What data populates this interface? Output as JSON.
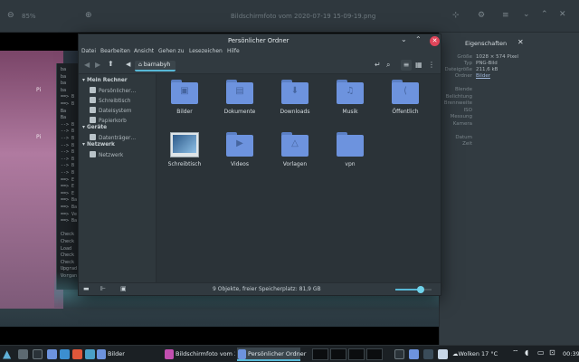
{
  "viewer": {
    "zoom": "85%",
    "title": "Bildschirmfoto vom 2020-07-19 15-09-19.png"
  },
  "properties": {
    "title": "Eigenschaften",
    "rows": [
      {
        "label": "Größe",
        "value": "1028 × 574 Pixel"
      },
      {
        "label": "Typ",
        "value": "PNG-Bild"
      },
      {
        "label": "Dateigröße",
        "value": "211,6 kB"
      },
      {
        "label": "Ordner",
        "value": "Bilder"
      }
    ],
    "labels_only": [
      "Blende",
      "Belichtung",
      "Brennweite",
      "ISO",
      "Messung",
      "Kamera",
      "",
      "Datum",
      "Zeit"
    ]
  },
  "file_manager": {
    "title": "Persönlicher Ordner",
    "menu": [
      "Datei",
      "Bearbeiten",
      "Ansicht",
      "Gehen zu",
      "Lesezeichen",
      "Hilfe"
    ],
    "path": "barnabyh",
    "sidebar": {
      "sections": [
        {
          "heading": "Mein Rechner",
          "items": [
            "Persönlicher…",
            "Schreibtisch",
            "Dateisystem",
            "Papierkorb"
          ]
        },
        {
          "heading": "Geräte",
          "items": [
            "Datenträger…"
          ]
        },
        {
          "heading": "Netzwerk",
          "items": [
            "Netzwerk"
          ]
        }
      ]
    },
    "items": [
      {
        "label": "Bilder",
        "glyph": "▣"
      },
      {
        "label": "Dokumente",
        "glyph": "▤"
      },
      {
        "label": "Downloads",
        "glyph": "⬇"
      },
      {
        "label": "Musik",
        "glyph": "♫"
      },
      {
        "label": "Öffentlich",
        "glyph": "⟨"
      },
      {
        "label": "Schreibtisch",
        "glyph": ""
      },
      {
        "label": "Videos",
        "glyph": "▶"
      },
      {
        "label": "Vorlagen",
        "glyph": "△"
      },
      {
        "label": "vpn",
        "glyph": ""
      }
    ],
    "status": "9 Objekte, freier Speicherplatz: 81,9 GB",
    "zoom_level": 0.7
  },
  "terminal_lines": [
    "ba",
    "ba",
    "ba",
    "ba",
    "==> B",
    "==> B",
    "Ba",
    "Ba",
    "--> B",
    "--> B",
    "--> B",
    "--> B",
    "--> B",
    "--> B",
    "--> B",
    "--> B",
    "==> E",
    "==> E",
    "==> E",
    "==> Ba",
    "==> Ba",
    "==> Ve",
    "==> Ba",
    "",
    "Check",
    "Check",
    "Load",
    "Check",
    "Check",
    "Upgrad",
    "Vorgan"
  ],
  "taskbar": {
    "items": [
      "Bilder",
      "Bildschirmfoto vom 2…",
      "Persönlicher Ordner"
    ],
    "weather": "Wolken 17 °C",
    "clock": "00:39"
  }
}
